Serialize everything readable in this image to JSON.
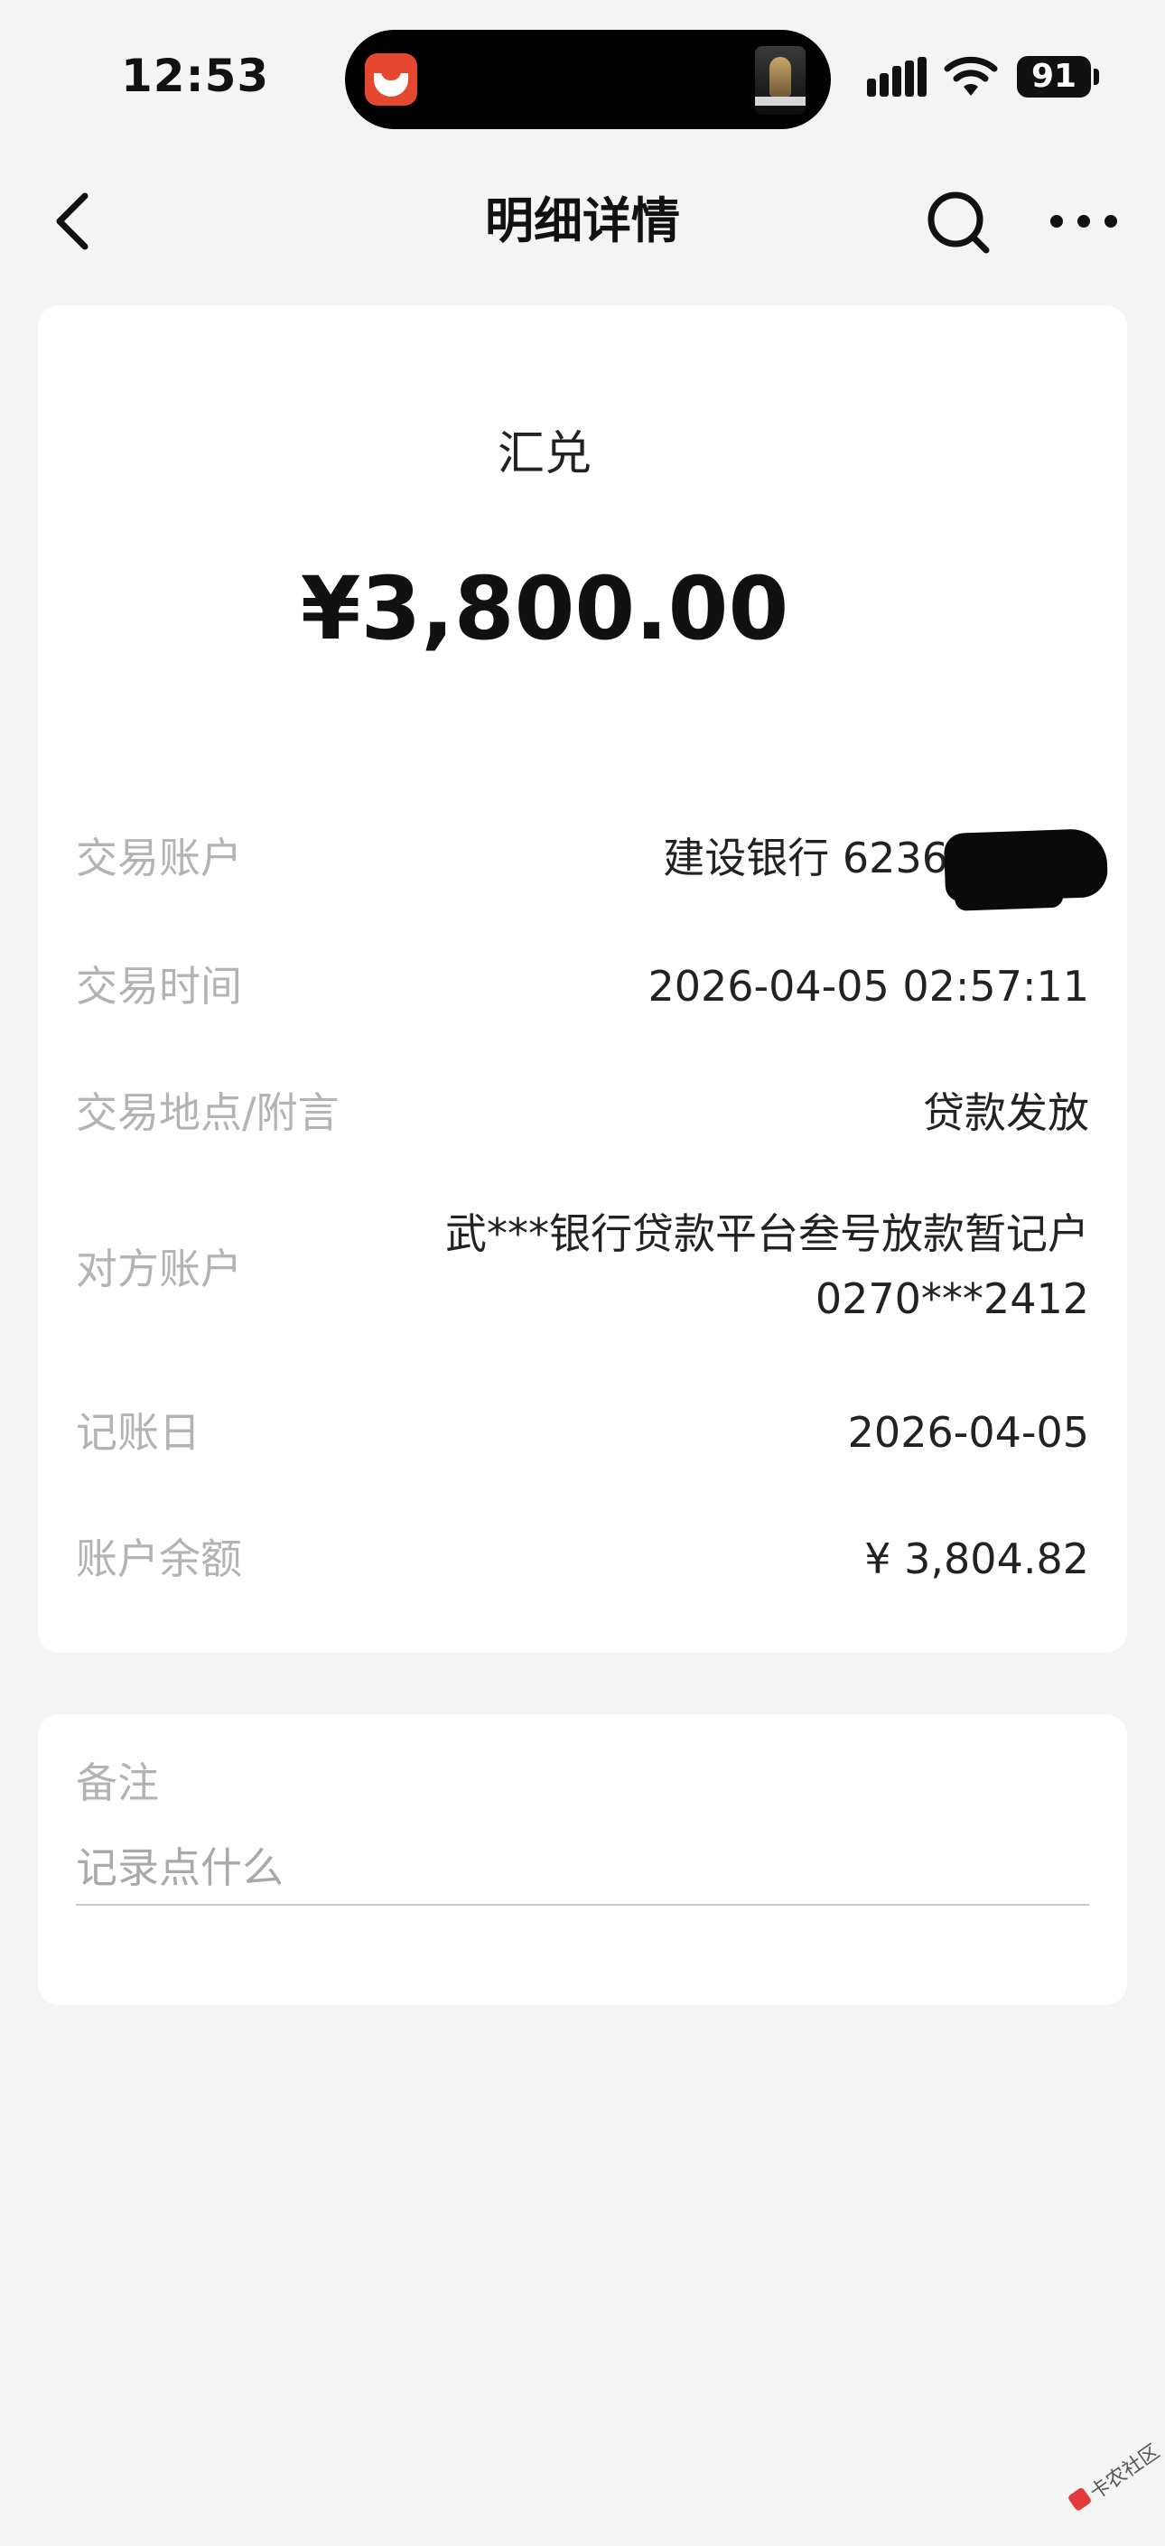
{
  "status_bar": {
    "time": "12:53",
    "battery": "91"
  },
  "nav": {
    "title": "明细详情"
  },
  "transaction": {
    "type": "汇兑",
    "amount": "¥3,800.00",
    "rows": [
      {
        "label": "交易账户",
        "value": "建设银行 6236**"
      },
      {
        "label": "交易时间",
        "value": "2026-04-05 02:57:11"
      },
      {
        "label": "交易地点/附言",
        "value": "贷款发放"
      },
      {
        "label": "对方账户",
        "value_line1": "武***银行贷款平台叁号放款暂记户",
        "value_line2": "0270***2412"
      },
      {
        "label": "记账日",
        "value": "2026-04-05"
      },
      {
        "label": "账户余额",
        "value": "¥ 3,804.82"
      }
    ]
  },
  "note": {
    "label": "备注",
    "placeholder": "记录点什么"
  },
  "watermark": {
    "text": "卡农社区"
  },
  "colors": {
    "background": "#f4f4f5",
    "card": "#ffffff",
    "label": "#b3b3b3",
    "text": "#111111",
    "app_icon": "#e5482f"
  }
}
